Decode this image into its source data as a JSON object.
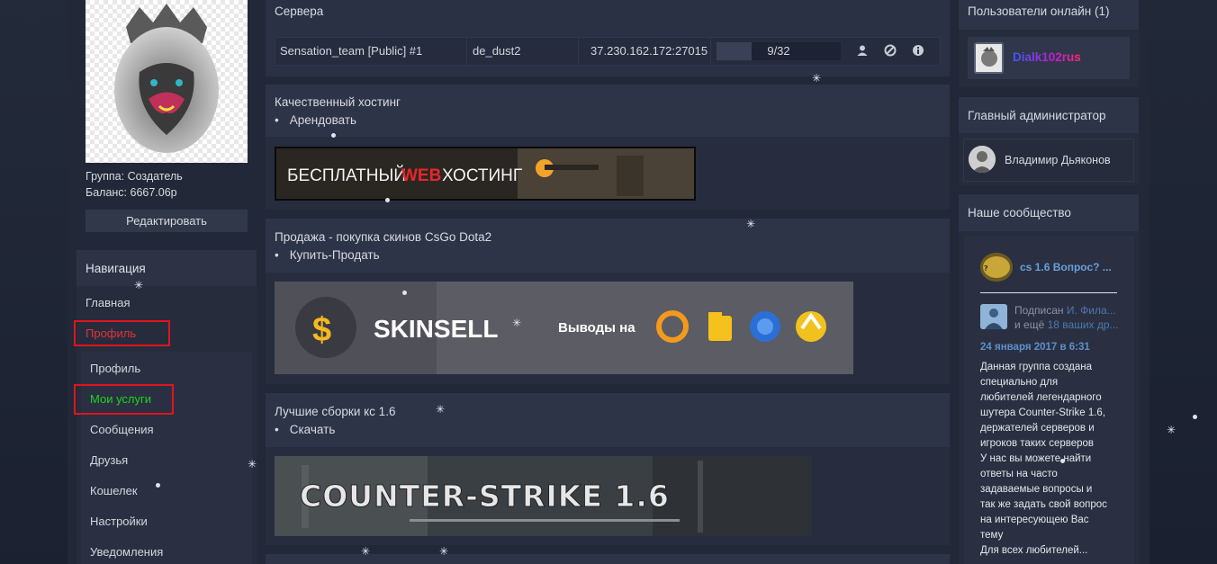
{
  "profile": {
    "group": "Группа: Создатель",
    "balance": "Баланс: 6667.06р",
    "edit_label": "Редактировать"
  },
  "nav": {
    "header": "Навигация",
    "home": "Главная",
    "profile": "Профиль",
    "sub": [
      {
        "label": "Профиль"
      },
      {
        "label": "Мои услуги"
      },
      {
        "label": "Сообщения"
      },
      {
        "label": "Друзья"
      },
      {
        "label": "Кошелек"
      },
      {
        "label": "Настройки"
      },
      {
        "label": "Уведомления"
      }
    ],
    "highlight_color": "#e0141d",
    "active_profile_color": "#e8313a",
    "active_services_color": "#22d11f"
  },
  "servers": {
    "title": "Сервера",
    "rows": [
      {
        "name": "Sensation_team [Public] #1",
        "map": "de_dust2",
        "address": "37.230.162.172:27015",
        "players": "9/32",
        "fill": 0.28,
        "icons": [
          "user-icon",
          "block-icon",
          "info-icon"
        ]
      }
    ]
  },
  "ads": [
    {
      "title": "Качественный хостинг",
      "link": "Арендовать",
      "banner": {
        "word1": "БЕСПЛАТНЫЙ",
        "word2": "WEB",
        "word3": "ХОСТИНГ"
      }
    },
    {
      "title": "Продажа - покупка скинов CsGo Dota2",
      "link": "Купить-Продать",
      "banner": {
        "brand": "SKINSELL",
        "withdraw": "Выводы на"
      }
    },
    {
      "title": "Лучшие сборки кс 1.6",
      "link": "Скачать",
      "banner": {
        "text": "COUNTER-STRIKE 1.6"
      }
    }
  ],
  "online": {
    "title": "Пользователи онлайн (1)",
    "user": "Dialk102rus"
  },
  "admin": {
    "title": "Главный администратор",
    "name": "Владимир Дьяконов"
  },
  "community": {
    "title": "Наше сообщество",
    "group_name": "cs 1.6 Вопрос? ...",
    "subscribed_prefix": "Подписан",
    "subscribed_name": "И. Фила...",
    "and_more_prefix": "и ещё",
    "and_more_link": "18 ваших др...",
    "date": "24 января 2017 в 6:31",
    "text": "Данная группа создана\nспециально для\nлюбителей легендарного\nшутера Counter-Strike 1.6,\nдержателей серверов и\nигроков таких серверов\nУ нас вы можете найти\nответы на часто\nзадаваемые вопросы и\nтак же задать свой вопрос\nна интересующею Вас\nтему\nДля всех любителей..."
  }
}
